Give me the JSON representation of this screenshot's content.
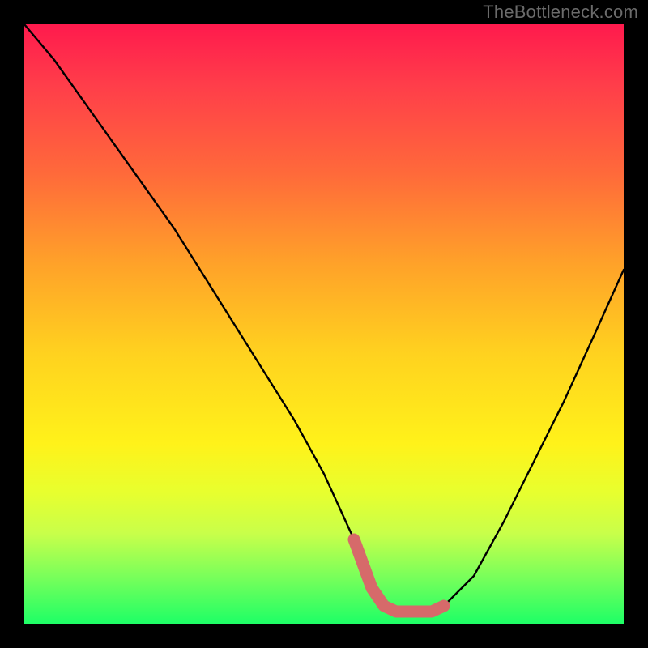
{
  "watermark": {
    "text": "TheBottleneck.com"
  },
  "chart_data": {
    "type": "line",
    "title": "",
    "xlabel": "",
    "ylabel": "",
    "xlim": [
      0,
      100
    ],
    "ylim": [
      0,
      100
    ],
    "grid": false,
    "legend": "none",
    "background": "rainbow-vertical-gradient",
    "series": [
      {
        "name": "bottleneck-curve",
        "color": "#000000",
        "x": [
          0,
          5,
          10,
          15,
          20,
          25,
          30,
          35,
          40,
          45,
          50,
          55,
          58,
          60,
          62,
          65,
          68,
          70,
          75,
          80,
          85,
          90,
          95,
          100
        ],
        "values": [
          100,
          94,
          87,
          80,
          73,
          66,
          58,
          50,
          42,
          34,
          25,
          14,
          6,
          3,
          2,
          2,
          2,
          3,
          8,
          17,
          27,
          37,
          48,
          59
        ]
      },
      {
        "name": "highlight-bottom-segment",
        "color": "#e57373",
        "stroke_width": 14,
        "x": [
          55,
          58,
          60,
          62,
          65,
          68,
          70
        ],
        "values": [
          14,
          6,
          3,
          2,
          2,
          2,
          3
        ]
      }
    ],
    "annotations": []
  }
}
